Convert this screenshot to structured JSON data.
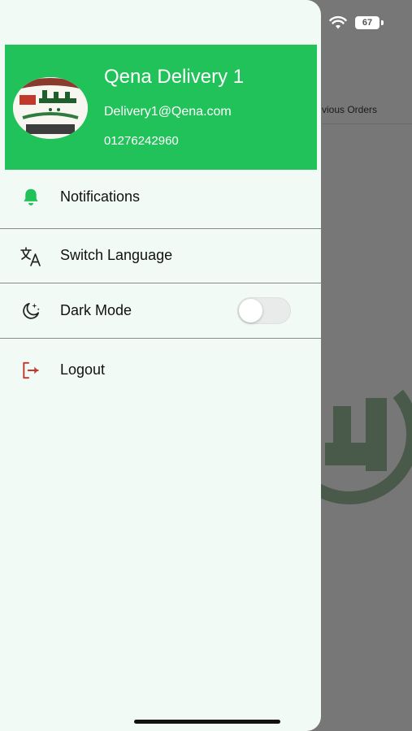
{
  "status_bar": {
    "time": "",
    "battery": "67"
  },
  "background": {
    "orders_label": "vious Orders"
  },
  "profile": {
    "name": "Qena Delivery 1",
    "email": "Delivery1@Qena.com",
    "phone": "01276242960"
  },
  "menu": {
    "notifications": {
      "label": "Notifications",
      "icon": "bell-icon"
    },
    "switch_language": {
      "label": "Switch Language",
      "icon": "translate-icon"
    },
    "dark_mode": {
      "label": "Dark Mode",
      "icon": "moon-stars-icon",
      "enabled": false
    },
    "logout": {
      "label": "Logout",
      "icon": "logout-icon"
    }
  },
  "colors": {
    "header_green": "#21c25a",
    "icon_green": "#21c25a",
    "logout_red": "#c0392b",
    "drawer_bg": "#f1faf5",
    "overlay": "#777777"
  }
}
